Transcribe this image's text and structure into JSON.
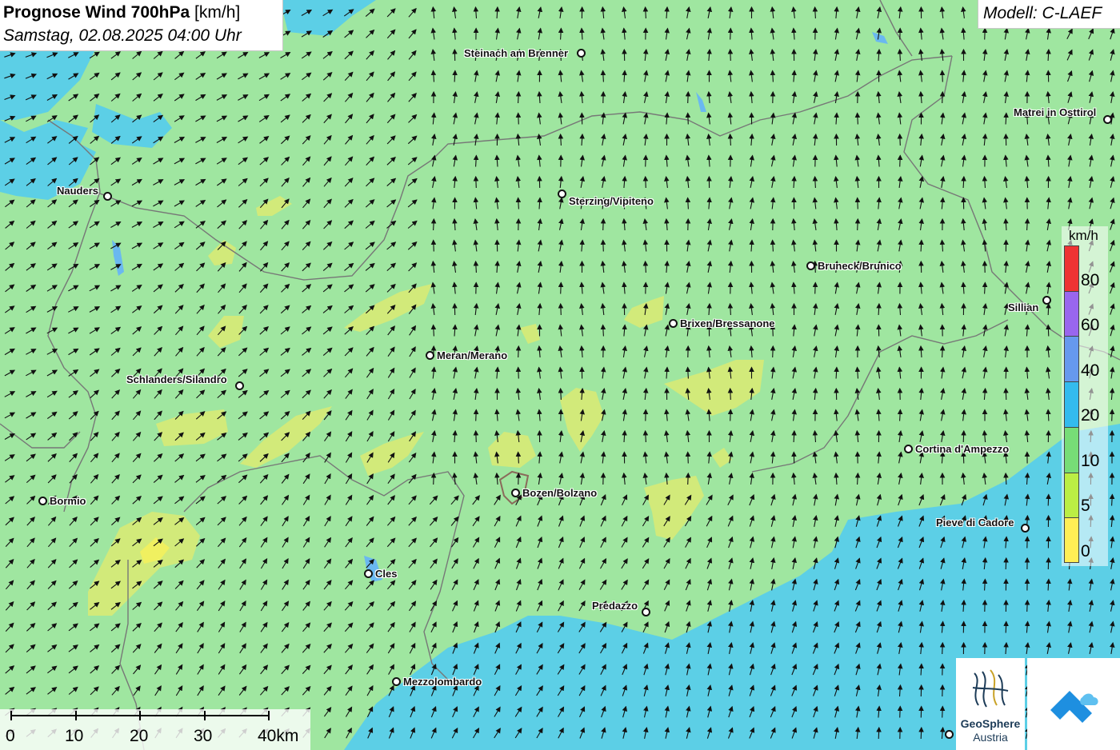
{
  "header": {
    "title_bold": "Prognose Wind 700hPa",
    "title_unit": "[km/h]",
    "subtitle": "Samstag, 02.08.2025 04:00 Uhr"
  },
  "model_label": "Modell: C-LAEF",
  "cities": [
    {
      "name": "Steinach am Brenner"
    },
    {
      "name": "Matrei in Osttirol"
    },
    {
      "name": "Nauders"
    },
    {
      "name": "Sterzing/Vipiteno"
    },
    {
      "name": "Bruneck/Brunico"
    },
    {
      "name": "Sillian"
    },
    {
      "name": "Brixen/Bressanone"
    },
    {
      "name": "Meran/Merano"
    },
    {
      "name": "Schlanders/Silandro"
    },
    {
      "name": "Cortina d'Ampezzo"
    },
    {
      "name": "Bormio"
    },
    {
      "name": "Bozen/Bolzano"
    },
    {
      "name": "Pieve di Cadore"
    },
    {
      "name": "Cles"
    },
    {
      "name": "Predazzo"
    },
    {
      "name": "Mezzolombardo"
    }
  ],
  "legend": {
    "unit": "km/h",
    "ticks": [
      "80",
      "60",
      "40",
      "20",
      "10",
      "5",
      "0"
    ],
    "colors": {
      "above_80": "#ee3333",
      "60_80": "#9966ee",
      "40_60": "#6699ee",
      "20_40": "#33bbee",
      "10_20": "#77dd77",
      "5_10": "#bbee44",
      "0_5": "#ffee55"
    }
  },
  "scale_bar": {
    "labels": [
      "0",
      "10",
      "20",
      "30",
      "40km"
    ]
  },
  "logos": {
    "geosphere_line1": "GeoSphere",
    "geosphere_line2": "Austria"
  }
}
